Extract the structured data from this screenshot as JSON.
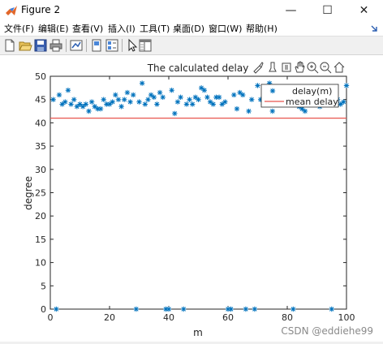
{
  "window": {
    "title": "Figure 2",
    "minimize_glyph": "—",
    "maximize_glyph": "☐",
    "close_glyph": "✕"
  },
  "menu": [
    {
      "label": "文件(F)"
    },
    {
      "label": "编辑(E)"
    },
    {
      "label": "查看(V)"
    },
    {
      "label": "插入(I)"
    },
    {
      "label": "工具(T)"
    },
    {
      "label": "桌面(D)"
    },
    {
      "label": "窗口(W)"
    },
    {
      "label": "帮助(H)"
    }
  ],
  "toolbar": {
    "icons": [
      "new-figure-icon",
      "open-file-icon",
      "save-icon",
      "print-icon",
      "link-plot-icon",
      "hide-plot-tools-icon",
      "show-plot-tools-icon",
      "edit-plot-icon",
      "property-inspector-icon"
    ]
  },
  "axes_toolbar": {
    "icons": [
      "brush-icon",
      "data-tips-icon",
      "rotate-icon",
      "pan-icon",
      "zoom-in-icon",
      "zoom-out-icon",
      "home-icon"
    ]
  },
  "watermark": "CSDN @eddiehe99",
  "colors": {
    "series": "#0072bd",
    "mean_line": "#e8554e"
  },
  "chart_data": {
    "type": "scatter",
    "title": "The calculated delay",
    "xlabel": "m",
    "ylabel": "degree",
    "xlim": [
      0,
      100
    ],
    "ylim": [
      0,
      50
    ],
    "xticks": [
      0,
      20,
      40,
      60,
      80,
      100
    ],
    "yticks": [
      0,
      5,
      10,
      15,
      20,
      25,
      30,
      35,
      40,
      45,
      50
    ],
    "grid": false,
    "legend_position": "top-right",
    "series": [
      {
        "name": "delay(m)",
        "marker": "asterisk",
        "x": [
          1,
          2,
          3,
          4,
          5,
          6,
          7,
          8,
          9,
          10,
          11,
          12,
          13,
          14,
          15,
          16,
          17,
          18,
          19,
          20,
          21,
          22,
          23,
          24,
          25,
          26,
          27,
          28,
          29,
          30,
          31,
          32,
          33,
          34,
          35,
          36,
          37,
          38,
          39,
          40,
          41,
          42,
          43,
          44,
          45,
          46,
          47,
          48,
          49,
          50,
          51,
          52,
          53,
          54,
          55,
          56,
          57,
          58,
          59,
          60,
          61,
          62,
          63,
          64,
          65,
          66,
          67,
          68,
          69,
          70,
          71,
          72,
          73,
          74,
          75,
          76,
          77,
          78,
          79,
          80,
          81,
          82,
          83,
          84,
          85,
          86,
          87,
          88,
          89,
          90,
          91,
          92,
          93,
          94,
          95,
          96,
          97,
          98,
          99,
          100
        ],
        "y": [
          45,
          0,
          46,
          44,
          44.5,
          47,
          44,
          45,
          43.5,
          44,
          43.5,
          44,
          42.5,
          44.5,
          43.5,
          43,
          43,
          45,
          44,
          44,
          44.5,
          46,
          45,
          43.5,
          45,
          46.5,
          44.5,
          46,
          0,
          44.5,
          48.5,
          44,
          45,
          46,
          45.5,
          44,
          46.5,
          45.5,
          0,
          0,
          47,
          42,
          44.5,
          45.5,
          0,
          44,
          45,
          44,
          45.5,
          45,
          47.5,
          47,
          45.5,
          44.5,
          44,
          45.5,
          45.5,
          44,
          44.5,
          0,
          0,
          46,
          43,
          46.5,
          46,
          0,
          42.5,
          45,
          0,
          48,
          45,
          44,
          46.5,
          48.5,
          42.5,
          45,
          47,
          46,
          44.5,
          45.5,
          46,
          0,
          44,
          43.5,
          43,
          42.5,
          45,
          44.5,
          44,
          44.5,
          43.5,
          46,
          45,
          45.5,
          0,
          46,
          45,
          44,
          44.5,
          48
        ]
      },
      {
        "name": "mean delay",
        "type": "line",
        "x": [
          0,
          100
        ],
        "y": [
          41,
          41
        ]
      }
    ]
  }
}
